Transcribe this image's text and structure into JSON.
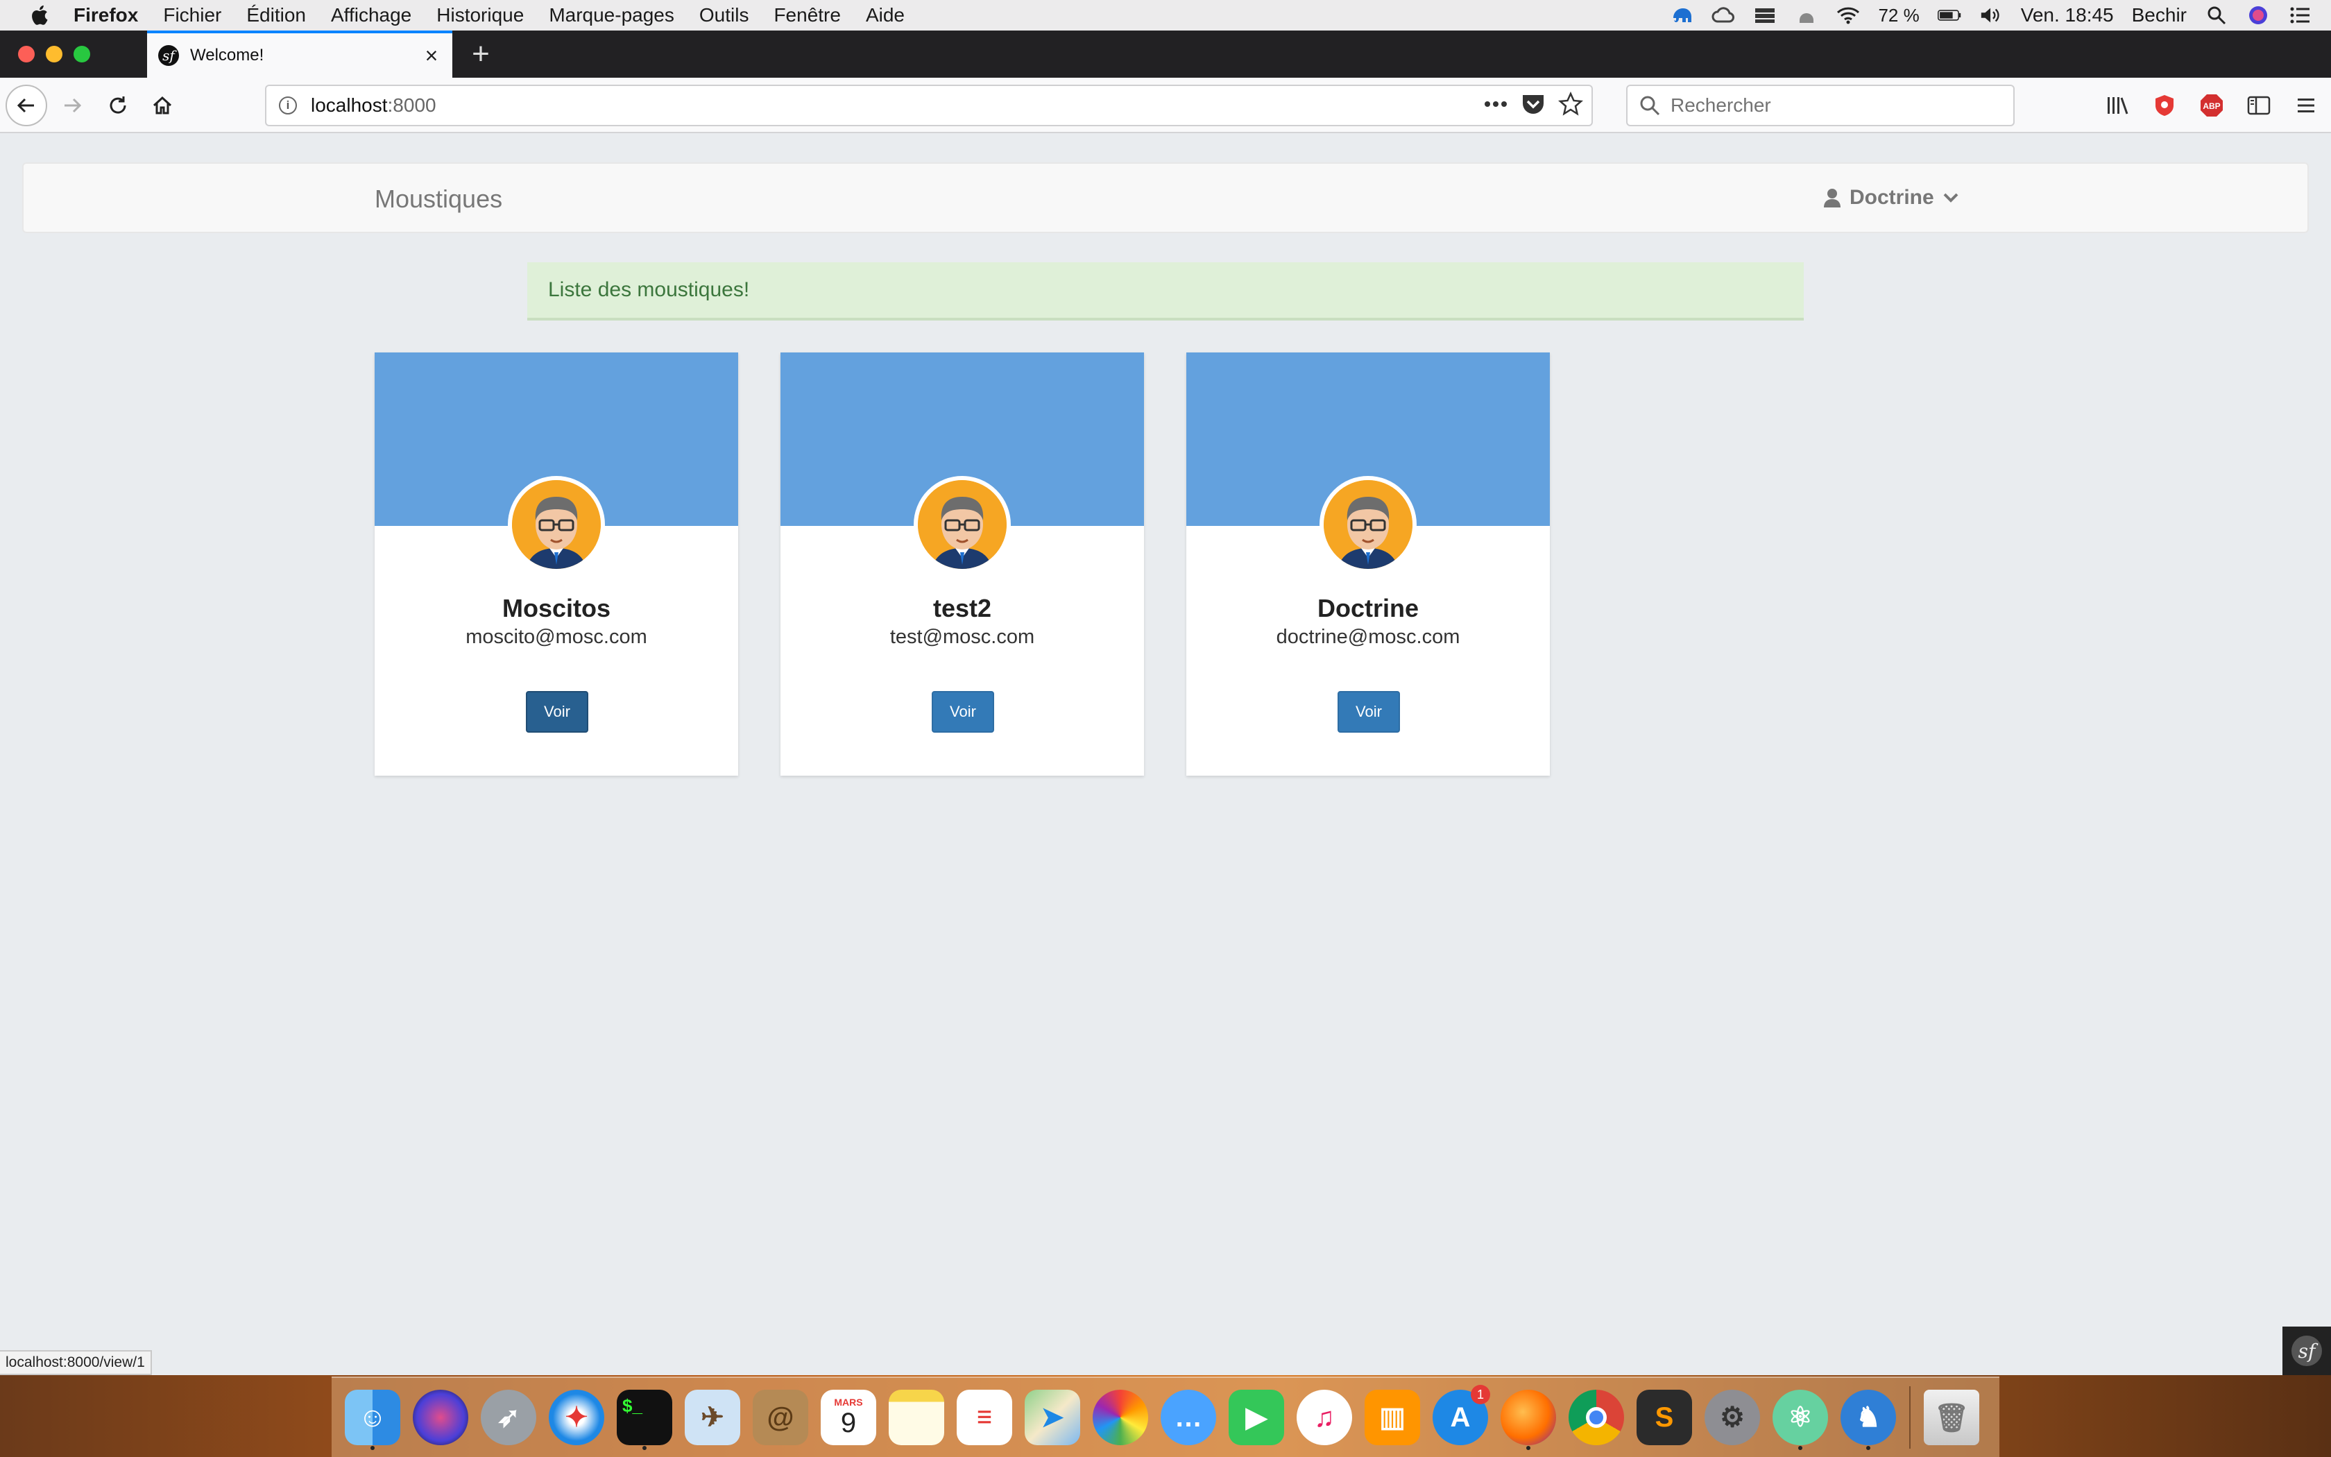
{
  "menubar": {
    "app_name": "Firefox",
    "items": [
      "Fichier",
      "Édition",
      "Affichage",
      "Historique",
      "Marque-pages",
      "Outils",
      "Fenêtre",
      "Aide"
    ],
    "battery": "72 %",
    "clock": "Ven. 18:45",
    "user": "Bechir"
  },
  "browser": {
    "tab_title": "Welcome!",
    "url_host": "localhost",
    "url_port": ":8000",
    "search_placeholder": "Rechercher",
    "status_url": "localhost:8000/view/1"
  },
  "site": {
    "brand": "Moustiques",
    "user_menu": "Doctrine",
    "alert": "Liste des moustiques!"
  },
  "cards": [
    {
      "name": "Moscitos",
      "email": "moscito@mosc.com",
      "button": "Voir"
    },
    {
      "name": "test2",
      "email": "test@mosc.com",
      "button": "Voir"
    },
    {
      "name": "Doctrine",
      "email": "doctrine@mosc.com",
      "button": "Voir"
    }
  ],
  "dock": {
    "calendar_month": "MARS",
    "calendar_day": "9",
    "appstore_badge": "1"
  },
  "colors": {
    "card_cover": "#63a1de",
    "button": "#337ab7",
    "alert_bg": "#dff0d8",
    "alert_text": "#3c763d",
    "tab_accent": "#0a84ff"
  }
}
